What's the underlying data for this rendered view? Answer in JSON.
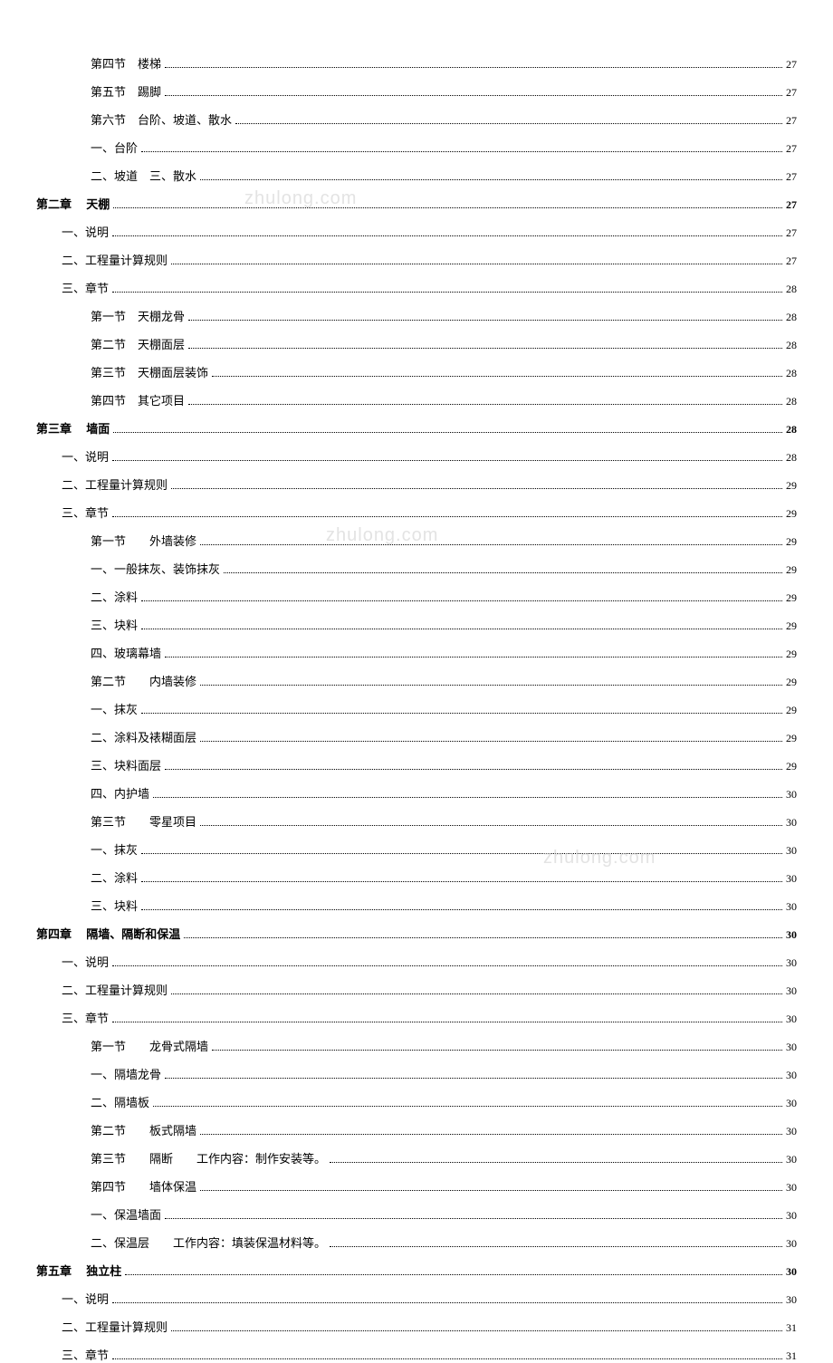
{
  "watermark": "zhulong.com",
  "toc": [
    {
      "label": "第四节　楼梯",
      "page": "27",
      "indent": 2,
      "bold": false
    },
    {
      "label": "第五节　踢脚",
      "page": "27",
      "indent": 2,
      "bold": false
    },
    {
      "label": "第六节　台阶、坡道、散水",
      "page": "27",
      "indent": 2,
      "bold": false
    },
    {
      "label": "一、台阶",
      "page": "27",
      "indent": 2,
      "bold": false
    },
    {
      "label": "二、坡道　三、散水",
      "page": "27",
      "indent": 2,
      "bold": false
    },
    {
      "label": "第二章　 天棚",
      "page": "27",
      "indent": 0,
      "bold": true
    },
    {
      "label": "一、说明",
      "page": "27",
      "indent": 1,
      "bold": false
    },
    {
      "label": "二、工程量计算规则",
      "page": "27",
      "indent": 1,
      "bold": false
    },
    {
      "label": "三、章节",
      "page": "28",
      "indent": 1,
      "bold": false
    },
    {
      "label": "第一节　天棚龙骨",
      "page": "28",
      "indent": 2,
      "bold": false
    },
    {
      "label": "第二节　天棚面层",
      "page": "28",
      "indent": 2,
      "bold": false
    },
    {
      "label": "第三节　天棚面层装饰",
      "page": "28",
      "indent": 2,
      "bold": false
    },
    {
      "label": "第四节　其它项目",
      "page": "28",
      "indent": 2,
      "bold": false
    },
    {
      "label": "第三章　 墙面",
      "page": "28",
      "indent": 0,
      "bold": true
    },
    {
      "label": "一、说明",
      "page": "28",
      "indent": 1,
      "bold": false
    },
    {
      "label": "二、工程量计算规则",
      "page": "29",
      "indent": 1,
      "bold": false
    },
    {
      "label": "三、章节",
      "page": "29",
      "indent": 1,
      "bold": false
    },
    {
      "label": "第一节　　外墙装修",
      "page": "29",
      "indent": 2,
      "bold": false
    },
    {
      "label": "一、一般抹灰、装饰抹灰",
      "page": "29",
      "indent": 2,
      "bold": false
    },
    {
      "label": "二、涂料",
      "page": "29",
      "indent": 2,
      "bold": false
    },
    {
      "label": "三、块料",
      "page": "29",
      "indent": 2,
      "bold": false
    },
    {
      "label": "四、玻璃幕墙",
      "page": "29",
      "indent": 2,
      "bold": false
    },
    {
      "label": "第二节　　内墙装修",
      "page": "29",
      "indent": 2,
      "bold": false
    },
    {
      "label": "一、抹灰",
      "page": "29",
      "indent": 2,
      "bold": false
    },
    {
      "label": "二、涂料及裱糊面层",
      "page": "29",
      "indent": 2,
      "bold": false
    },
    {
      "label": "三、块料面层",
      "page": "29",
      "indent": 2,
      "bold": false
    },
    {
      "label": "四、内护墙",
      "page": "30",
      "indent": 2,
      "bold": false
    },
    {
      "label": "第三节　　零星项目",
      "page": "30",
      "indent": 2,
      "bold": false
    },
    {
      "label": "一、抹灰",
      "page": "30",
      "indent": 2,
      "bold": false
    },
    {
      "label": "二、涂料",
      "page": "30",
      "indent": 2,
      "bold": false
    },
    {
      "label": "三、块料",
      "page": "30",
      "indent": 2,
      "bold": false
    },
    {
      "label": "第四章　 隔墙、隔断和保温",
      "page": "30",
      "indent": 0,
      "bold": true
    },
    {
      "label": "一、说明",
      "page": "30",
      "indent": 1,
      "bold": false
    },
    {
      "label": "二、工程量计算规则",
      "page": "30",
      "indent": 1,
      "bold": false
    },
    {
      "label": "三、章节",
      "page": "30",
      "indent": 1,
      "bold": false
    },
    {
      "label": "第一节　　龙骨式隔墙",
      "page": "30",
      "indent": 2,
      "bold": false
    },
    {
      "label": "一、隔墙龙骨",
      "page": "30",
      "indent": 2,
      "bold": false
    },
    {
      "label": "二、隔墙板",
      "page": "30",
      "indent": 2,
      "bold": false
    },
    {
      "label": "第二节　　板式隔墙",
      "page": "30",
      "indent": 2,
      "bold": false
    },
    {
      "label": "第三节　　隔断　　工作内容：制作安装等。",
      "page": "30",
      "indent": 2,
      "bold": false
    },
    {
      "label": "第四节　　墙体保温",
      "page": "30",
      "indent": 2,
      "bold": false
    },
    {
      "label": "一、保温墙面",
      "page": "30",
      "indent": 2,
      "bold": false
    },
    {
      "label": "二、保温层　　工作内容：填装保温材料等。",
      "page": "30",
      "indent": 2,
      "bold": false
    },
    {
      "label": "第五章　 独立柱",
      "page": "30",
      "indent": 0,
      "bold": true
    },
    {
      "label": "一、说明",
      "page": "30",
      "indent": 1,
      "bold": false
    },
    {
      "label": "二、工程量计算规则",
      "page": "31",
      "indent": 1,
      "bold": false
    },
    {
      "label": "三、章节",
      "page": "31",
      "indent": 1,
      "bold": false
    }
  ]
}
